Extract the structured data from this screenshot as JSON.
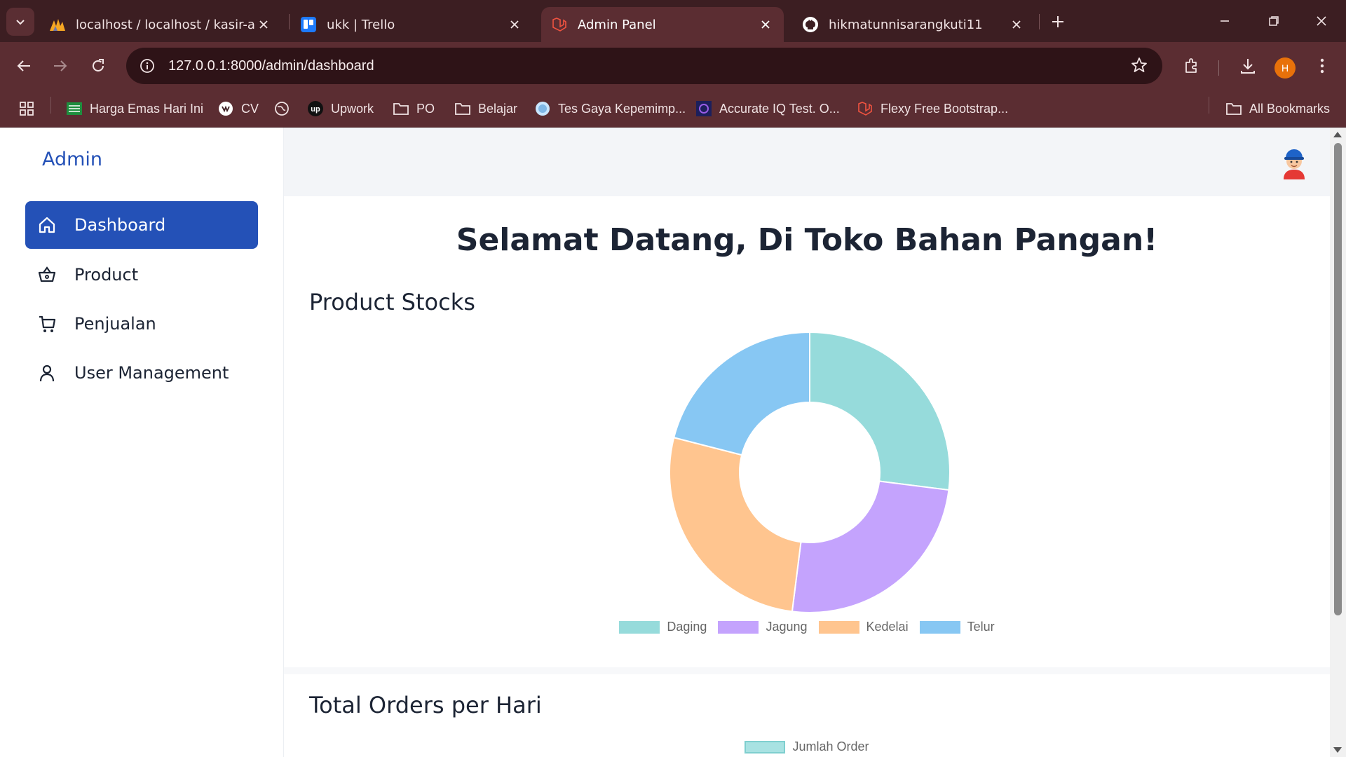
{
  "browser": {
    "tabs": [
      {
        "title": "localhost / localhost / kasir-app",
        "active": false
      },
      {
        "title": "ukk | Trello",
        "active": false
      },
      {
        "title": "Admin Panel",
        "active": true
      },
      {
        "title": "hikmatunnisarangkuti11",
        "active": false
      }
    ],
    "url": "127.0.0.1:8000/admin/dashboard",
    "profile_initial": "H",
    "bookmarks": [
      {
        "label": "Harga Emas Hari Ini",
        "icon": "sheet-icon"
      },
      {
        "label": "CV",
        "icon": "cv-icon"
      },
      {
        "label": "",
        "icon": "globe-icon"
      },
      {
        "label": "Upwork",
        "icon": "upwork-icon"
      },
      {
        "label": "PO",
        "icon": "folder-icon"
      },
      {
        "label": "Belajar",
        "icon": "folder-icon"
      },
      {
        "label": "Tes Gaya Kepemimp...",
        "icon": "test-icon"
      },
      {
        "label": "Accurate IQ Test. O...",
        "icon": "iq-icon"
      },
      {
        "label": "Flexy Free Bootstrap...",
        "icon": "flexy-icon"
      }
    ],
    "all_bookmarks": "All Bookmarks"
  },
  "sidebar": {
    "brand": "Admin",
    "items": [
      {
        "label": "Dashboard",
        "icon": "home-icon",
        "active": true
      },
      {
        "label": "Product",
        "icon": "basket-icon",
        "active": false
      },
      {
        "label": "Penjualan",
        "icon": "cart-icon",
        "active": false
      },
      {
        "label": "User Management",
        "icon": "user-icon",
        "active": false
      }
    ]
  },
  "main": {
    "welcome": "Selamat Datang, Di Toko Bahan Pangan!",
    "stocks_title": "Product Stocks",
    "orders_title": "Total Orders per Hari",
    "orders_legend": "Jumlah Order"
  },
  "chart_data": [
    {
      "type": "pie",
      "variant": "doughnut",
      "categories": [
        "Daging",
        "Jagung",
        "Kedelai",
        "Telur"
      ],
      "values": [
        27,
        25,
        27,
        21
      ],
      "colors": [
        "#96dbdb",
        "#c4a3fd",
        "#ffc58f",
        "#87c7f3"
      ],
      "legend": "bottom"
    }
  ]
}
